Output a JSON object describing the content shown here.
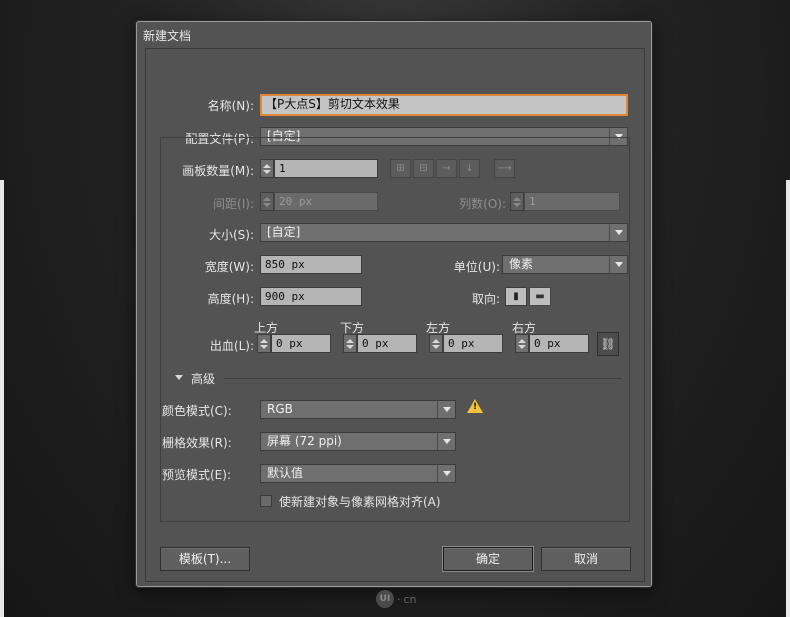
{
  "dialog": {
    "title": "新建文档"
  },
  "name": {
    "label": "名称(N):",
    "value": "【P大点S】剪切文本效果"
  },
  "profile": {
    "label": "配置文件(P):",
    "value": "[自定]"
  },
  "artboards": {
    "label": "画板数量(M):",
    "value": "1",
    "spacing_label": "间距(I):",
    "spacing_value": "20 px",
    "columns_label": "列数(O):",
    "columns_value": "1",
    "layout_icons": [
      "grid-by-row-icon",
      "grid-by-column-icon",
      "arrange-by-row-icon",
      "arrange-by-column-icon"
    ],
    "direction_icon": "right-to-left-arrow-icon"
  },
  "size": {
    "label": "大小(S):",
    "value": "[自定]"
  },
  "width": {
    "label": "宽度(W):",
    "value": "850 px"
  },
  "height": {
    "label": "高度(H):",
    "value": "900 px"
  },
  "units": {
    "label": "单位(U):",
    "value": "像素"
  },
  "orientation": {
    "label": "取向:",
    "icons": [
      "portrait-icon",
      "landscape-icon"
    ]
  },
  "bleed": {
    "label": "出血(L):",
    "top_label": "上方",
    "top_value": "0 px",
    "bottom_label": "下方",
    "bottom_value": "0 px",
    "left_label": "左方",
    "left_value": "0 px",
    "right_label": "右方",
    "right_value": "0 px",
    "link_icon": "chain-link-icon"
  },
  "advanced": {
    "label": "高级",
    "color_mode_label": "颜色模式(C):",
    "color_mode_value": "RGB",
    "raster_label": "栅格效果(R):",
    "raster_value": "屏幕 (72 ppi)",
    "preview_label": "预览模式(E):",
    "preview_value": "默认值",
    "align_pixel_label": "使新建对象与像素网格对齐(A)"
  },
  "buttons": {
    "templates": "模板(T)...",
    "ok": "确定",
    "cancel": "取消"
  },
  "watermark": {
    "text": "cn",
    "logo": "UI"
  },
  "colors": {
    "dialog_bg": "#535353",
    "focus": "#e0883a",
    "warning": "#f2c23a"
  }
}
